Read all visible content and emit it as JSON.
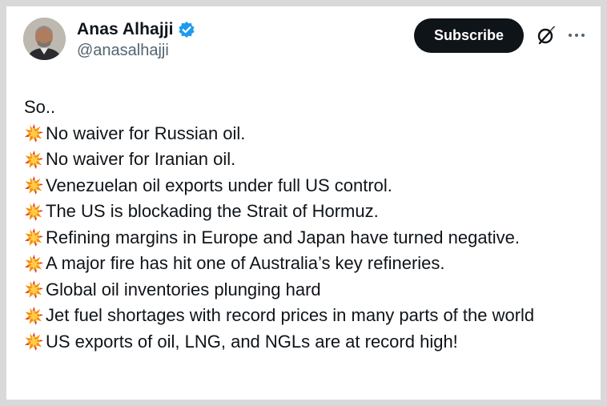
{
  "author": {
    "display_name": "Anas Alhajji",
    "handle": "@anasalhajji",
    "verified": true
  },
  "actions": {
    "subscribe_label": "Subscribe",
    "grok_icon": "grok-icon",
    "more_icon": "more-icon"
  },
  "post": {
    "intro": "So..",
    "bullet_icon": "collision-emoji-icon",
    "items": [
      "No waiver for Russian oil.",
      "No waiver for Iranian oil.",
      "Venezuelan oil exports under full US control.",
      "The US is blockading the Strait of Hormuz.",
      "Refining margins in Europe and Japan have turned negative.",
      "A major fire has hit one of Australia’s key refineries.",
      "Global oil inventories plunging hard",
      "Jet fuel shortages with record prices in many parts of the world",
      "US exports of oil, LNG, and NGLs are at record high!"
    ]
  },
  "colors": {
    "text_primary": "#0f1419",
    "text_secondary": "#536471",
    "verified_blue": "#1d9bf0",
    "button_bg": "#0f1419"
  }
}
